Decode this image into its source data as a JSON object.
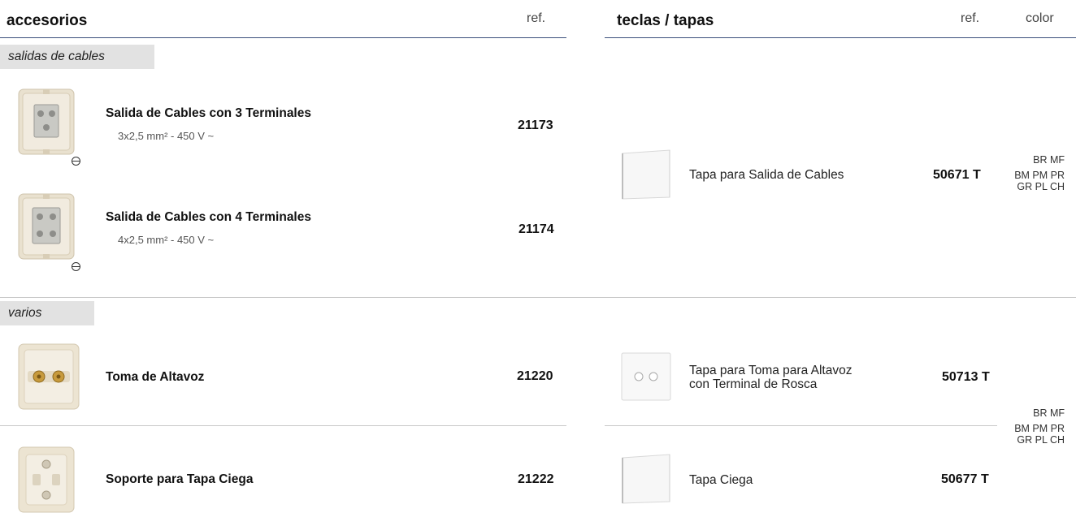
{
  "left": {
    "title": "accesorios",
    "ref_header": "ref.",
    "sections": [
      {
        "label": "salidas de cables",
        "items": [
          {
            "name": "Salida de Cables con 3 Terminales",
            "spec": "3x2,5 mm² - 450 V ~",
            "ref": "21173",
            "icon": "screw-terminal-icon"
          },
          {
            "name": "Salida de Cables con 4 Terminales",
            "spec": "4x2,5 mm² - 450 V ~",
            "ref": "21174",
            "icon": "screw-terminal-icon"
          }
        ]
      },
      {
        "label": "varios",
        "items": [
          {
            "name": "Toma de Altavoz",
            "ref": "21220"
          },
          {
            "name": "Soporte para Tapa Ciega",
            "ref": "21222"
          }
        ]
      }
    ]
  },
  "right": {
    "title": "teclas / tapas",
    "ref_header": "ref.",
    "color_header": "color",
    "items": [
      {
        "name": "Tapa para Salida de Cables",
        "ref": "50671 T",
        "colors": [
          "BR MF",
          "BM PM PR",
          "GR PL CH"
        ]
      },
      {
        "name_line1": "Tapa para Toma para Altavoz",
        "name_line2": "con Terminal de Rosca",
        "ref": "50713 T"
      },
      {
        "name": "Tapa Ciega",
        "ref": "50677 T"
      }
    ],
    "shared_colors": [
      "BR MF",
      "BM PM PR",
      "GR PL CH"
    ]
  }
}
